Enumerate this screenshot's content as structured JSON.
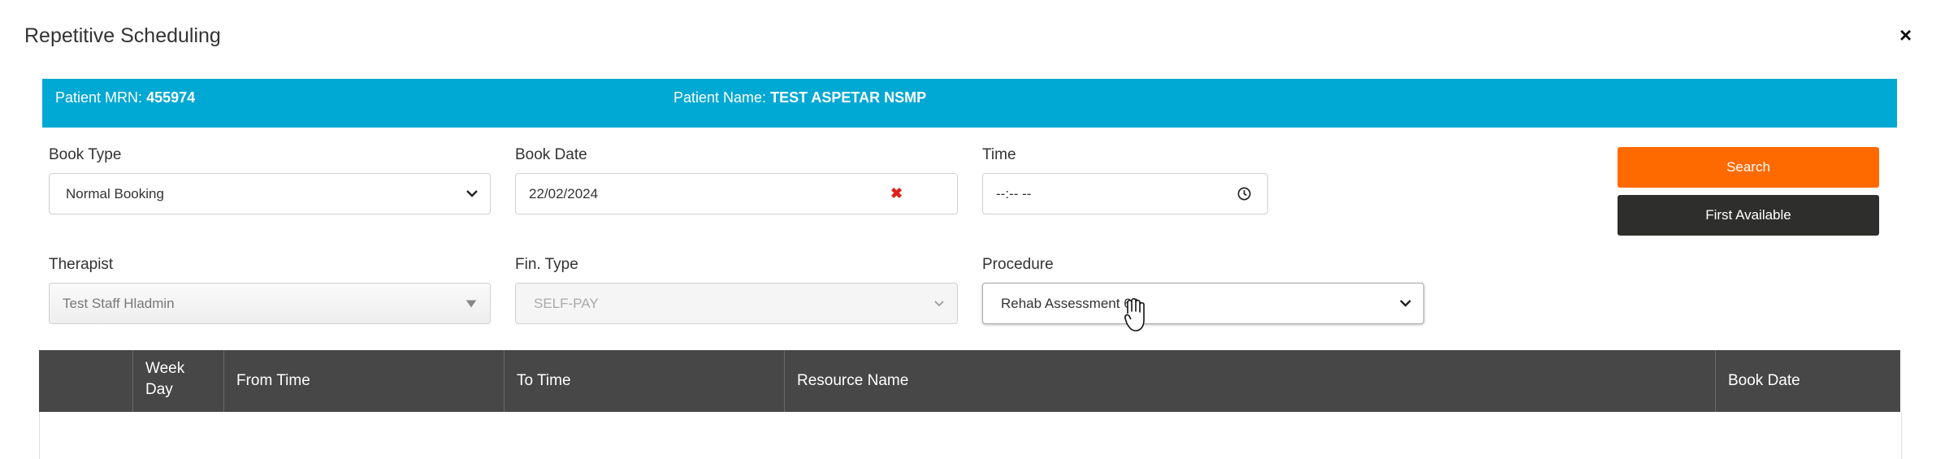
{
  "modal": {
    "title": "Repetitive Scheduling",
    "close_symbol": "×"
  },
  "patient": {
    "mrn_label": "Patient MRN:",
    "mrn_value": "455974",
    "name_label": "Patient Name:",
    "name_value": "TEST ASPETAR NSMP",
    "bar_color": "#00a8d4"
  },
  "form": {
    "book_type": {
      "label": "Book Type",
      "value": "Normal Booking"
    },
    "book_date": {
      "label": "Book Date",
      "value": "22/02/2024",
      "clear_symbol": "✖"
    },
    "time": {
      "label": "Time",
      "value": "--:-- --"
    },
    "therapist": {
      "label": "Therapist",
      "value": "Test Staff Hladmin"
    },
    "fin_type": {
      "label": "Fin. Type",
      "value": "SELF-PAY"
    },
    "procedure": {
      "label": "Procedure",
      "value": "Rehab Assessment 60"
    }
  },
  "buttons": {
    "search": {
      "label": "Search",
      "color": "#ff6a00"
    },
    "first_available": {
      "label": "First Available",
      "color": "#2e2f2c"
    }
  },
  "table": {
    "columns": [
      "",
      "Week Day",
      "From Time",
      "To Time",
      "Resource Name",
      "Book Date"
    ],
    "rows": []
  }
}
